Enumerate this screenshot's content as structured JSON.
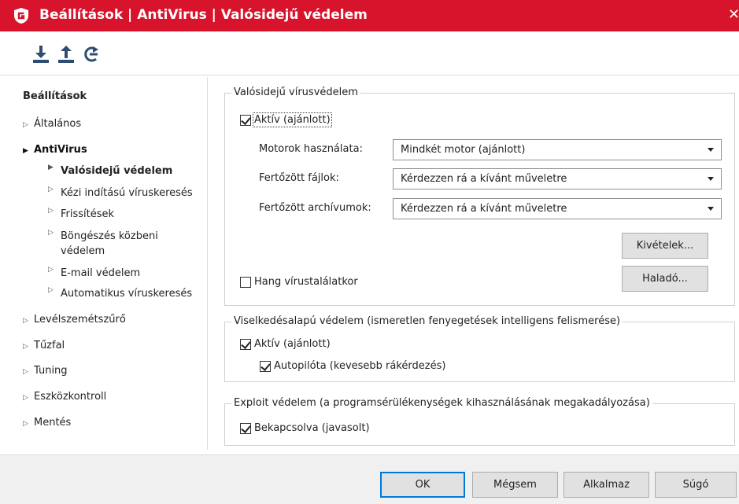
{
  "window": {
    "title": "Beállítások | AntiVirus | Valósidejű védelem",
    "close_glyph": "✕",
    "brand_color": "#d7142c"
  },
  "toolbar": {
    "buttons": [
      {
        "icon": "import-icon"
      },
      {
        "icon": "export-icon"
      },
      {
        "icon": "reset-icon"
      }
    ]
  },
  "sidebar": {
    "heading": "Beállítások",
    "items": [
      {
        "label": "Általános"
      },
      {
        "label": "AntiVirus"
      },
      {
        "label": "Levélszemétszűrő"
      },
      {
        "label": "Tűzfal"
      },
      {
        "label": "Tuning"
      },
      {
        "label": "Eszközkontroll"
      },
      {
        "label": "Mentés"
      }
    ],
    "antivirus_children": [
      {
        "label": "Valósidejű védelem"
      },
      {
        "label": "Kézi indítású víruskeresés"
      },
      {
        "label": "Frissítések"
      },
      {
        "label": "Böngészés közbeni védelem"
      },
      {
        "label": "E-mail védelem"
      },
      {
        "label": "Automatikus víruskeresés"
      }
    ]
  },
  "realtime": {
    "group_title": "Valósidejű vírusvédelem",
    "active_label": "Aktív (ajánlott)",
    "active_checked": true,
    "engines_label": "Motorok használata:",
    "engines_value": "Mindkét motor (ajánlott)",
    "infected_files_label": "Fertőzött fájlok:",
    "infected_files_value": "Kérdezzen rá a kívánt műveletre",
    "infected_archives_label": "Fertőzött archívumok:",
    "infected_archives_value": "Kérdezzen rá a kívánt műveletre",
    "exceptions_button": "Kivételek...",
    "sound_label": "Hang vírustalálatkor",
    "sound_checked": false,
    "advanced_button": "Haladó..."
  },
  "behavior": {
    "group_title": "Viselkedésalapú védelem (ismeretlen fenyegetések intelligens felismerése)",
    "active_label": "Aktív (ajánlott)",
    "active_checked": true,
    "autopilot_label": "Autopilóta (kevesebb rákérdezés)",
    "autopilot_checked": true
  },
  "exploit": {
    "group_title": "Exploit védelem (a programsérülékenységek kihasználásának megakadályozása)",
    "enabled_label": "Bekapcsolva (javasolt)",
    "enabled_checked": true
  },
  "footer": {
    "ok": "OK",
    "cancel": "Mégsem",
    "apply": "Alkalmaz",
    "help": "Súgó"
  }
}
